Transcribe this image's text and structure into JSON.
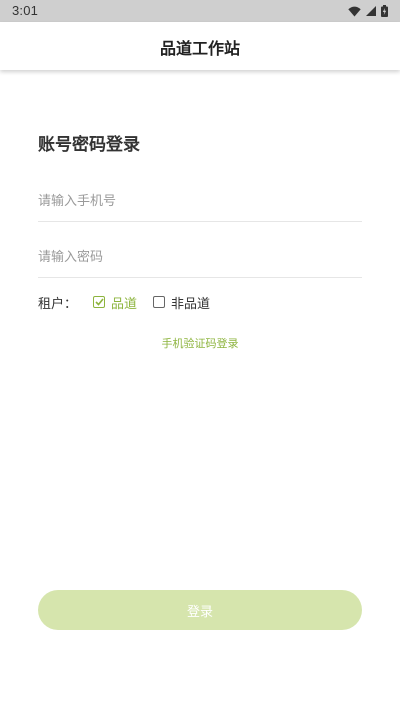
{
  "status_bar": {
    "time": "3:01",
    "icons": [
      "wifi-icon",
      "signal-icon",
      "battery-charging-icon"
    ]
  },
  "app_bar": {
    "title": "品道工作站"
  },
  "form": {
    "heading": "账号密码登录",
    "phone_placeholder": "请输入手机号",
    "password_placeholder": "请输入密码",
    "tenant": {
      "label": "租户：",
      "options": [
        {
          "label": "品道",
          "checked": true
        },
        {
          "label": "非品道",
          "checked": false
        }
      ]
    },
    "sms_login_link": "手机验证码登录",
    "submit_label": "登录"
  },
  "colors": {
    "accent": "#8db43e",
    "button_disabled": "#d6e5ad",
    "status_bar": "#cfcfcf"
  }
}
